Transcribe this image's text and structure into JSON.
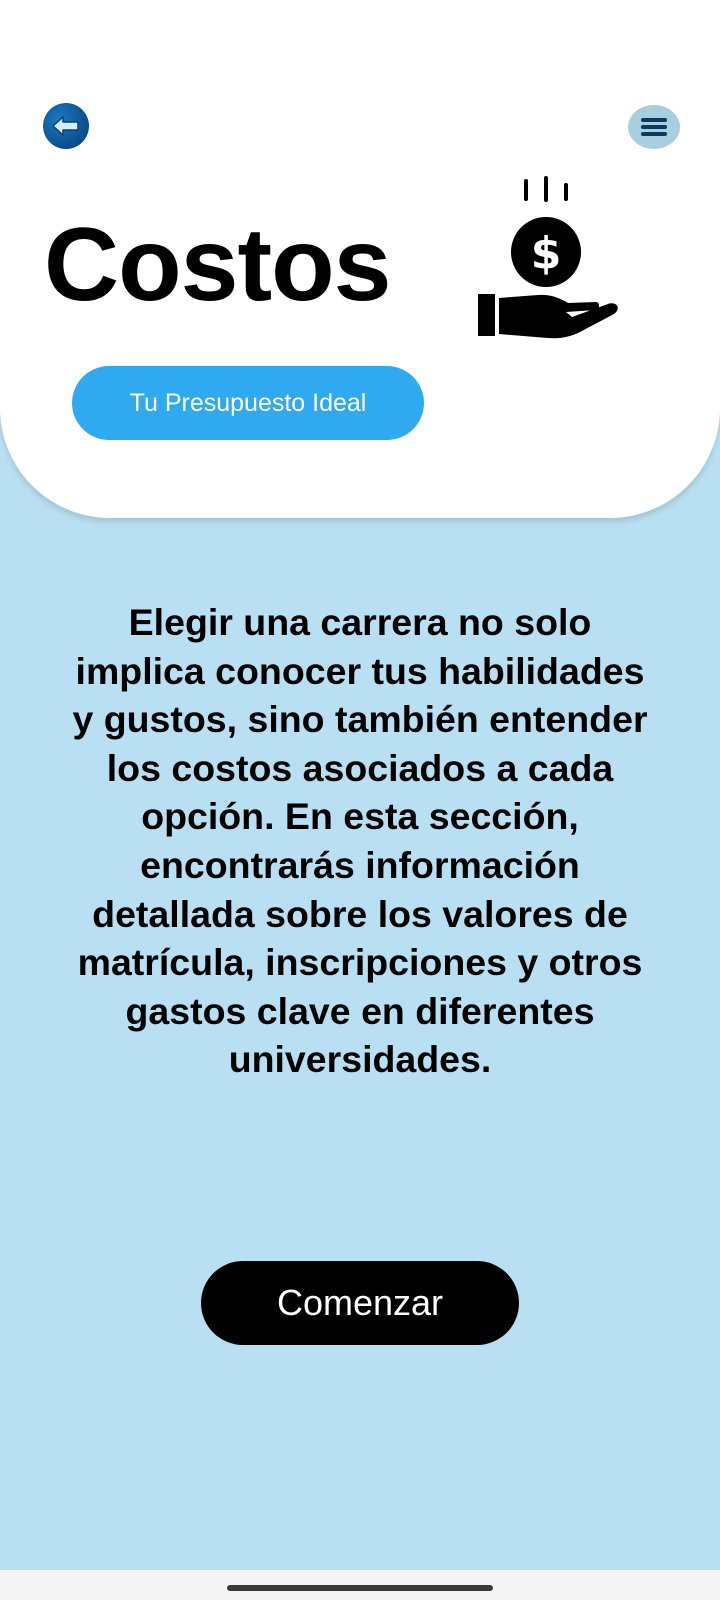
{
  "header": {
    "back_icon": "arrow-left-icon",
    "menu_icon": "hamburger-menu-icon",
    "title": "Costos",
    "illustration": "hand-receiving-coin-icon",
    "budget_button_label": "Tu Presupuesto Ideal"
  },
  "main": {
    "description": "Elegir una carrera no solo implica conocer tus habilidades y gustos, sino también entender los costos asociados a cada opción. En esta sección, encontrarás información detallada sobre los valores de matrícula, inscripciones y otros gastos clave en diferentes universidades.",
    "start_button_label": "Comenzar"
  },
  "colors": {
    "background": "#b8e0f2",
    "card": "#ffffff",
    "accent_button": "#2fa9ef",
    "back_button": "#0a4d8c",
    "menu_button": "#a9cfdf",
    "primary_button": "#000000"
  }
}
